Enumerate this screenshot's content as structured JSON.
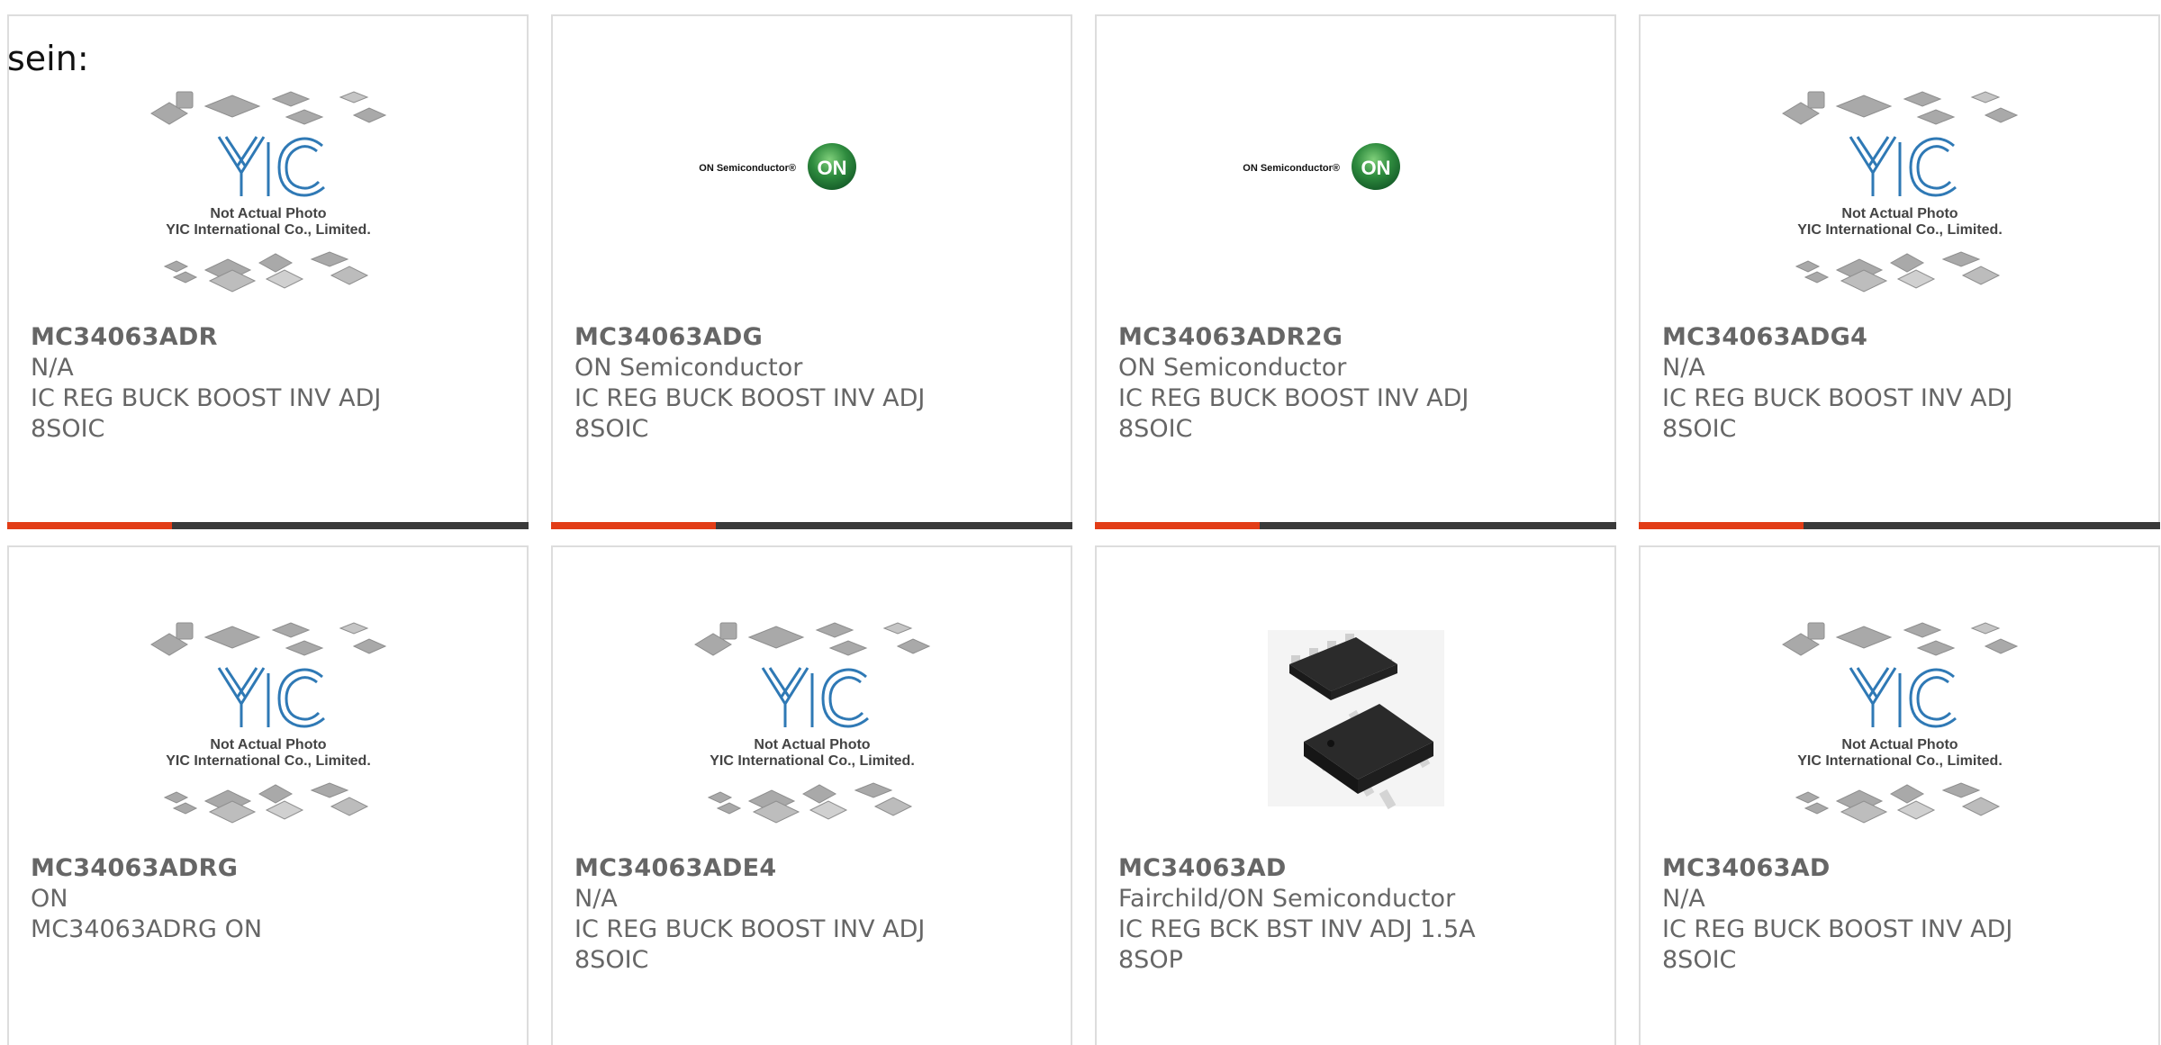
{
  "lead_text": "sein:",
  "colors": {
    "accent": "#e23d17",
    "bar": "#3a3a3a",
    "border": "#dddddd",
    "text": "#666666",
    "yic_blue": "#1e6fa8",
    "on_green": "#2e8b3e"
  },
  "placeholder": {
    "line1": "Not Actual Photo",
    "line2": "YIC International Co., Limited."
  },
  "on_logo": {
    "name": "ON Semiconductor®",
    "badge": "ON"
  },
  "products": [
    {
      "part": "MC34063ADR",
      "maker": "N/A",
      "desc": "IC REG BUCK BOOST INV ADJ",
      "pkg": "8SOIC",
      "image": "yic-placeholder-icon"
    },
    {
      "part": "MC34063ADG",
      "maker": "ON Semiconductor",
      "desc": "IC REG BUCK BOOST INV ADJ",
      "pkg": "8SOIC",
      "image": "on-semiconductor-logo-icon"
    },
    {
      "part": "MC34063ADR2G",
      "maker": "ON Semiconductor",
      "desc": "IC REG BUCK BOOST INV ADJ",
      "pkg": "8SOIC",
      "image": "on-semiconductor-logo-icon"
    },
    {
      "part": "MC34063ADG4",
      "maker": "N/A",
      "desc": "IC REG BUCK BOOST INV ADJ",
      "pkg": "8SOIC",
      "image": "yic-placeholder-icon"
    },
    {
      "part": "MC34063ADRG",
      "maker": "ON",
      "desc": "MC34063ADRG ON",
      "pkg": "",
      "image": "yic-placeholder-icon"
    },
    {
      "part": "MC34063ADE4",
      "maker": "N/A",
      "desc": "IC REG BUCK BOOST INV ADJ",
      "pkg": "8SOIC",
      "image": "yic-placeholder-icon"
    },
    {
      "part": "MC34063AD",
      "maker": "Fairchild/ON Semiconductor",
      "desc": "IC REG BCK BST INV ADJ 1.5A",
      "pkg": "8SOP",
      "image": "soic-chip-photo-icon"
    },
    {
      "part": "MC34063AD",
      "maker": "N/A",
      "desc": "IC REG BUCK BOOST INV ADJ",
      "pkg": "8SOIC",
      "image": "yic-placeholder-icon"
    }
  ]
}
